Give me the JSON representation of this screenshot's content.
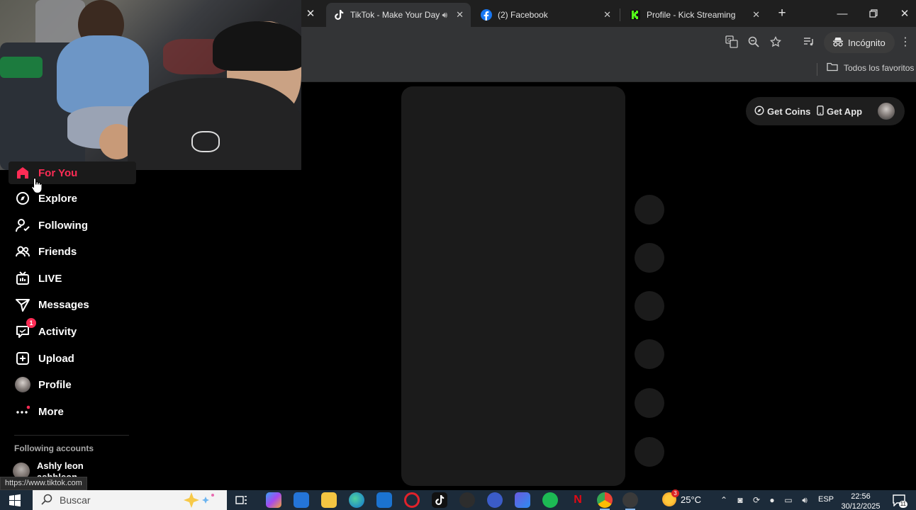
{
  "browser": {
    "tabs": [
      {
        "title": "TikTok - Make Your Day",
        "active": true
      },
      {
        "title": "(2) Facebook",
        "active": false
      },
      {
        "title": "Profile - Kick Streaming",
        "active": false
      }
    ],
    "new_tab": "+",
    "incognito_label": "Incógnito",
    "bookmarks_label": "Todos los favoritos",
    "status_url": "https://www.tiktok.com"
  },
  "tiktok": {
    "nav": [
      {
        "label": "For You",
        "icon": "home-icon",
        "active": true
      },
      {
        "label": "Explore",
        "icon": "compass-icon"
      },
      {
        "label": "Following",
        "icon": "following-icon"
      },
      {
        "label": "Friends",
        "icon": "friends-icon"
      },
      {
        "label": "LIVE",
        "icon": "live-icon"
      },
      {
        "label": "Messages",
        "icon": "messages-icon"
      },
      {
        "label": "Activity",
        "icon": "activity-icon",
        "badge": "1"
      },
      {
        "label": "Upload",
        "icon": "upload-icon"
      },
      {
        "label": "Profile",
        "icon": "avatar-icon"
      },
      {
        "label": "More",
        "icon": "more-icon"
      }
    ],
    "following_title": "Following accounts",
    "following_accounts": [
      {
        "name": "Ashly leon",
        "handle": "ashhleon"
      }
    ],
    "get_coins": "Get Coins",
    "get_app": "Get App",
    "accent": "#fe2c55"
  },
  "taskbar": {
    "search_placeholder": "Buscar",
    "weather": "25°C",
    "weather_badge": "3",
    "language": "ESP",
    "time": "22:56",
    "date": "30/12/2025",
    "notification_count": "11"
  }
}
